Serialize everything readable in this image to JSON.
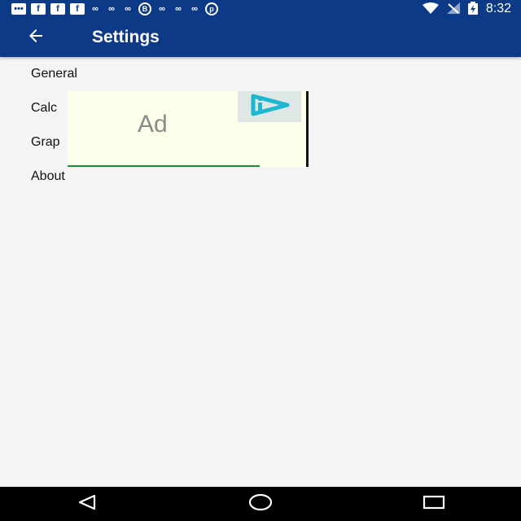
{
  "status_bar": {
    "left_icons": [
      "chat-bubble-icon",
      "facebook-icon",
      "facebook-icon",
      "facebook-icon",
      "infinity-icon",
      "infinity-icon",
      "infinity-icon",
      "b-circle-icon",
      "infinity-icon",
      "infinity-icon",
      "infinity-icon",
      "pinterest-icon"
    ],
    "right_icons": [
      "wifi-icon",
      "cell-signal-off-icon",
      "battery-charging-icon"
    ],
    "time": "8:32"
  },
  "app_bar": {
    "title": "Settings",
    "back_icon": "arrow-left-icon"
  },
  "settings": {
    "items": [
      {
        "label": "General"
      },
      {
        "label": "Calc"
      },
      {
        "label": "Grap"
      },
      {
        "label": "About"
      }
    ]
  },
  "ad": {
    "label": "Ad",
    "logo_icon": "ad-choices-icon"
  },
  "nav_bar": {
    "icons": [
      "back-triangle-icon",
      "home-circle-icon",
      "recents-square-icon"
    ]
  },
  "colors": {
    "primary": "#0d3a87",
    "background": "#f4f4f4",
    "ad_background": "#fbffe9",
    "ad_logo": "#1cb8d0",
    "nav_bar": "#000000"
  }
}
